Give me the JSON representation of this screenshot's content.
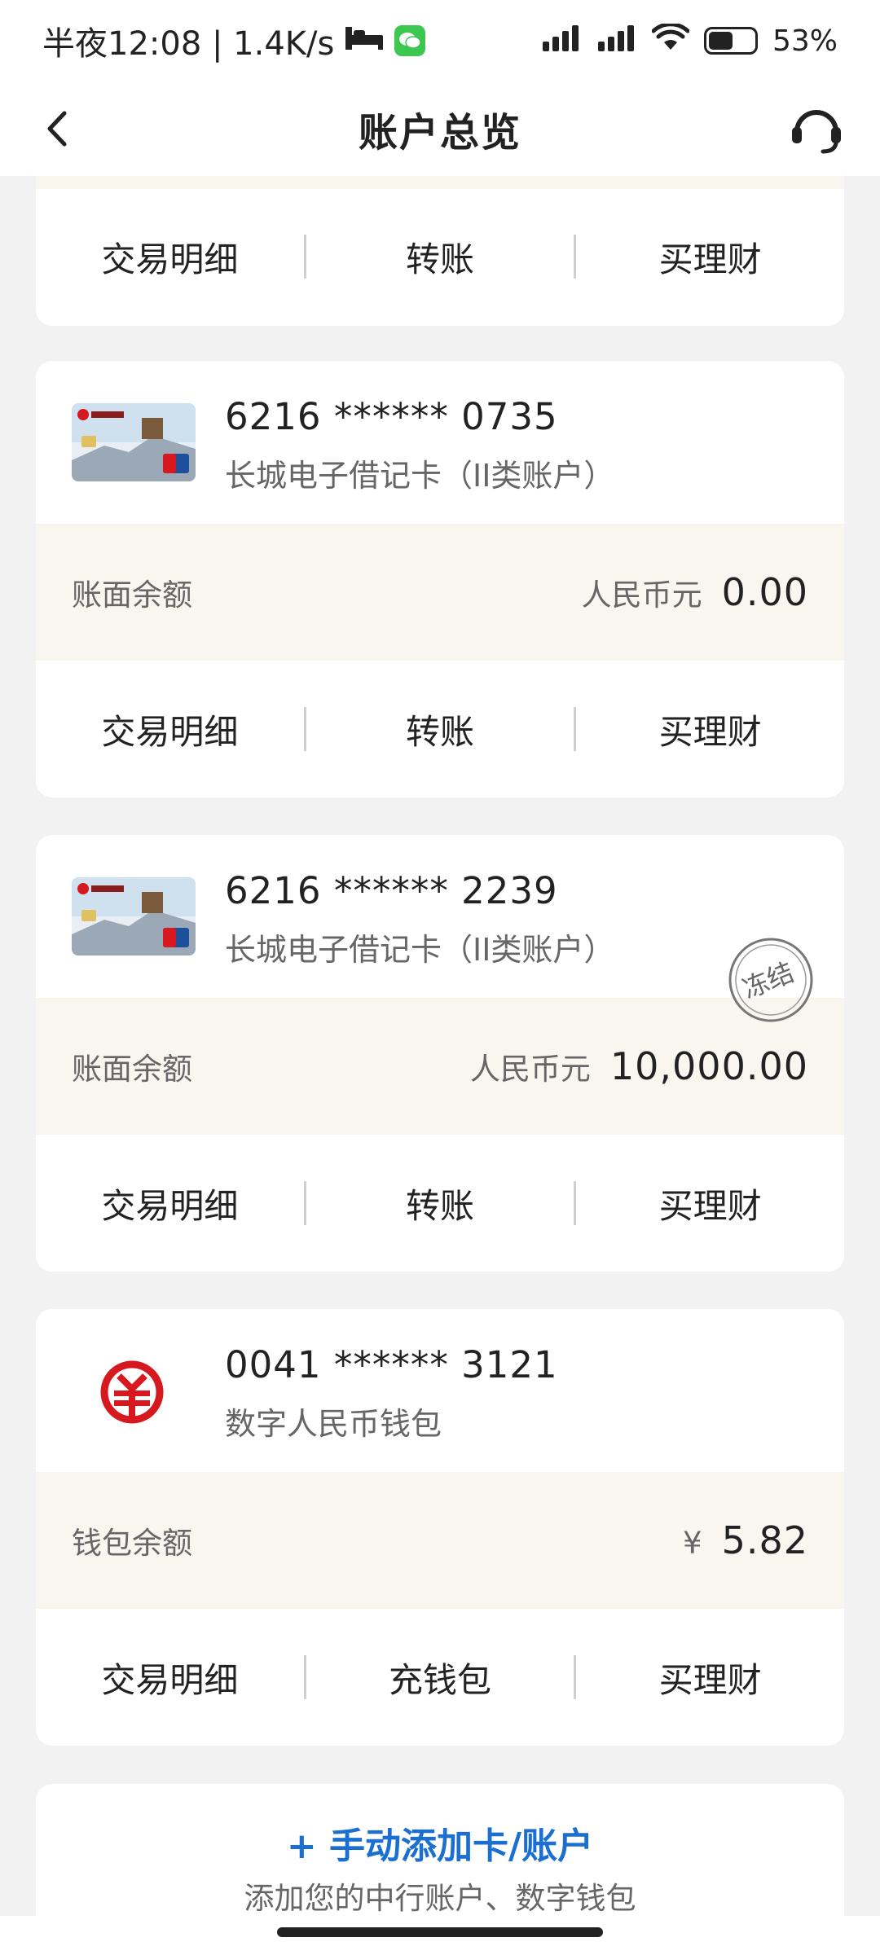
{
  "status_bar": {
    "time": "半夜12:08 | 1.4K/s",
    "battery": "53%",
    "icons": [
      "bed-icon",
      "wechat-icon",
      "signal-icon",
      "signal-icon",
      "wifi-icon",
      "battery-icon"
    ]
  },
  "nav": {
    "title": "账户总览",
    "icons": [
      "back-chevron-icon",
      "customer-service-icon"
    ]
  },
  "accounts": [
    {
      "actions": [
        "交易明细",
        "转账",
        "买理财"
      ]
    },
    {
      "number": "6216 ****** 0735",
      "type": "长城电子借记卡（II类账户）",
      "balance_label": "账面余额",
      "currency": "人民币元",
      "amount": "0.00",
      "actions": [
        "交易明细",
        "转账",
        "买理财"
      ]
    },
    {
      "number": "6216 ****** 2239",
      "type": "长城电子借记卡（II类账户）",
      "stamp": "冻结",
      "balance_label": "账面余额",
      "currency": "人民币元",
      "amount": "10,000.00",
      "actions": [
        "交易明细",
        "转账",
        "买理财"
      ]
    },
    {
      "number": "0041 ****** 3121",
      "type": "数字人民币钱包",
      "balance_label": "钱包余额",
      "currency": "¥",
      "amount": "5.82",
      "actions": [
        "交易明细",
        "充钱包",
        "买理财"
      ]
    }
  ],
  "add_account": {
    "title": "+ 手动添加卡/账户",
    "subtitle": "添加您的中行账户、数字钱包"
  },
  "colors": {
    "accent_blue": "#1a6fd1",
    "ecny_red": "#d7181f",
    "balance_bg": "#f9f6f0",
    "page_bg": "#f2f2f2"
  }
}
